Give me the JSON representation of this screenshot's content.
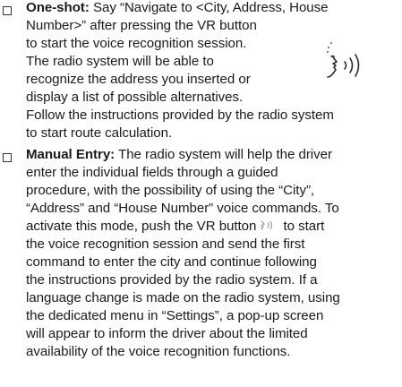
{
  "items": [
    {
      "lead": "One-shot:",
      "lines": [
        " Say “Navigate to <City, Address, House",
        "Number>” after pressing the VR button",
        "to start the voice recognition session.",
        "The radio system will be able to",
        "recognize the address you inserted or",
        "display a list of possible alternatives.",
        "Follow the instructions provided by the radio system",
        "to start route calculation."
      ]
    },
    {
      "lead": "Manual Entry:",
      "lines": [
        " The radio system will help the driver",
        "enter the individual fields through a guided",
        "procedure, with the possibility of using the “City”,",
        "“Address” and “House Number” voice commands. To",
        "activate this mode, push the VR button",
        " to start",
        "the voice recognition session and send the first",
        "command to enter the city and continue following",
        "the instructions provided by the radio system. If a",
        "language change is made on the radio system, using",
        "the dedicated menu in “Settings”, a pop-up screen",
        "will appear to inform the driver about the limited",
        "availability of the voice recognition functions."
      ]
    }
  ],
  "icons": {
    "speaking_head": "speaking-head-icon",
    "vr_button": "vr-button-icon"
  }
}
